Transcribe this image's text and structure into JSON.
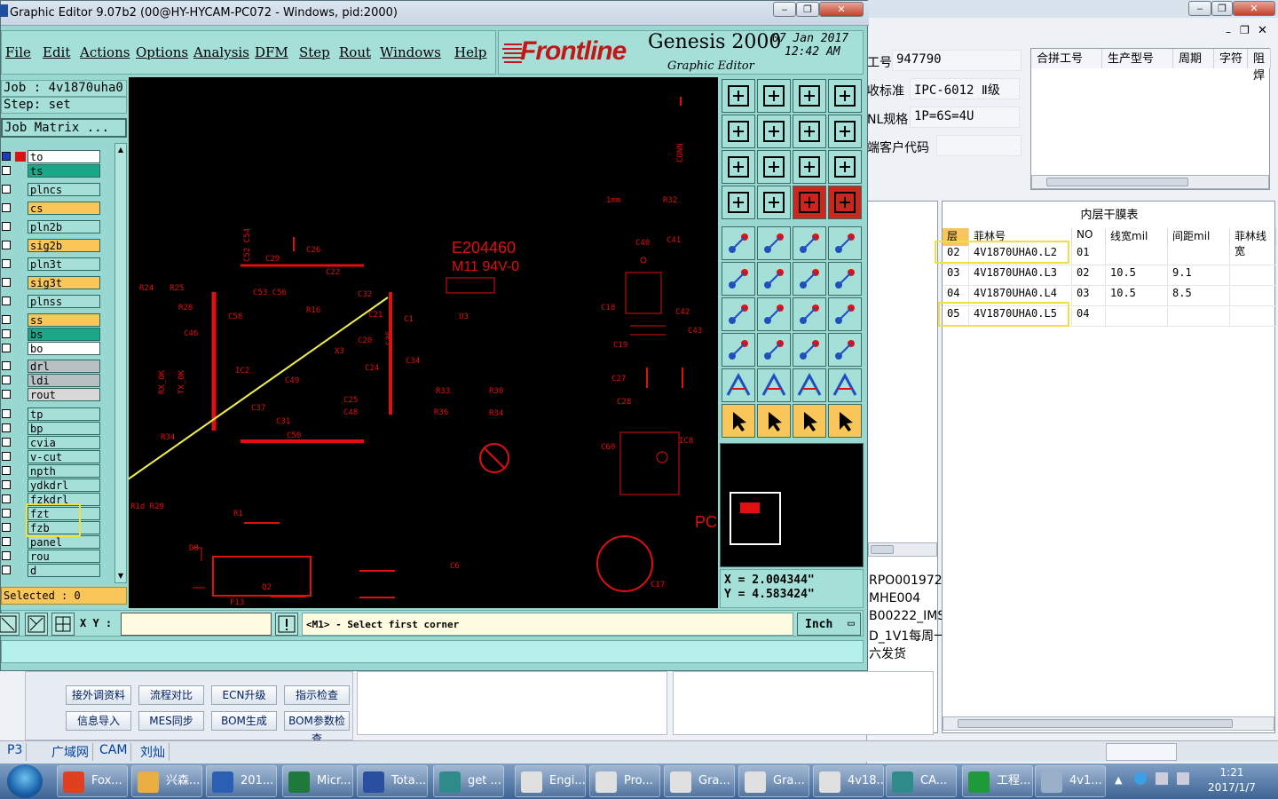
{
  "window": {
    "title": "Graphic Editor 9.07b2 (00@HY-HYCAM-PC072 - Windows, pid:2000)",
    "min_icon": "minimize-icon",
    "max_icon": "maximize-icon",
    "close_icon": "close-icon"
  },
  "menu": [
    "File",
    "Edit",
    "Actions",
    "Options",
    "Analysis",
    "DFM",
    "Step",
    "Rout",
    "Windows",
    "Help"
  ],
  "brand": {
    "logo": "Frontline",
    "product": "Genesis 2000",
    "date": "07 Jan 2017",
    "time": "12:42 AM",
    "subtitle": "Graphic Editor"
  },
  "job": {
    "job_line": "Job : 4v1870uha0",
    "step_line": "Step: set",
    "matrix_button": "Job Matrix ..."
  },
  "layers": [
    {
      "name": "to",
      "color": "#ffffff"
    },
    {
      "name": "ts",
      "color": "#1aa888"
    },
    {
      "name": "plncs",
      "color": "#a5e0d8"
    },
    {
      "name": "cs",
      "color": "#f9c65a"
    },
    {
      "name": "pln2b",
      "color": "#a5e0d8"
    },
    {
      "name": "sig2b",
      "color": "#f9c65a"
    },
    {
      "name": "pln3t",
      "color": "#a5e0d8"
    },
    {
      "name": "sig3t",
      "color": "#f9c65a"
    },
    {
      "name": "plnss",
      "color": "#a5e0d8"
    },
    {
      "name": "ss",
      "color": "#f9c65a"
    },
    {
      "name": "bs",
      "color": "#1aa888"
    },
    {
      "name": "bo",
      "color": "#ffffff"
    },
    {
      "name": "drl",
      "color": "#b8c0c4"
    },
    {
      "name": "ldi",
      "color": "#b8c0c4"
    },
    {
      "name": "rout",
      "color": "#d8d8d8"
    },
    {
      "name": "tp",
      "color": "#a5e0d8"
    },
    {
      "name": "bp",
      "color": "#a5e0d8"
    },
    {
      "name": "cvia",
      "color": "#a5e0d8"
    },
    {
      "name": "v-cut",
      "color": "#a5e0d8"
    },
    {
      "name": "npth",
      "color": "#a5e0d8"
    },
    {
      "name": "ydkdrl",
      "color": "#a5e0d8"
    },
    {
      "name": "fzkdrl",
      "color": "#a5e0d8"
    },
    {
      "name": "fzt",
      "color": "#a5e0d8"
    },
    {
      "name": "fzb",
      "color": "#a5e0d8"
    },
    {
      "name": "panel",
      "color": "#a5e0d8"
    },
    {
      "name": "rou",
      "color": "#a5e0d8"
    },
    {
      "name": "d",
      "color": "#a5e0d8"
    }
  ],
  "selected_line": "Selected : 0",
  "coords": {
    "x_line": "X = 2.004344\"",
    "y_line": "Y = 4.583424\""
  },
  "bottombar": {
    "xy_label": "X Y :",
    "xy_value": "",
    "prompt": "<M1> - Select first corner",
    "unit": "Inch"
  },
  "pcb_labels": {
    "ul": "E204460",
    "material": "M11 94V-0",
    "parts": [
      "R32",
      "1mm",
      "CONN",
      "C26",
      "C29",
      "C22",
      "C52",
      "C54",
      "C32",
      "C21",
      "C1",
      "U3",
      "R24",
      "R25",
      "R28",
      "R26",
      "C53",
      "C56",
      "C58",
      "C46",
      "C33",
      "R16",
      "C30",
      "C36",
      "C20",
      "X3",
      "C24",
      "C34",
      "C40",
      "C41",
      "X1",
      "C42",
      "C18",
      "C43",
      "X2",
      "C19",
      "C27",
      "C28",
      "R33",
      "R30",
      "R36",
      "R34",
      "IC2",
      "C49",
      "C37",
      "C25",
      "C48",
      "C47",
      "C31",
      "C50",
      "R34",
      "RX_OK",
      "TX_OK",
      "C60",
      "IC8",
      "R1d R29",
      "R1",
      "D8",
      "Q2",
      "F13",
      "C6",
      "C5",
      "C17",
      "PC"
    ]
  },
  "bg_app": {
    "fields": [
      {
        "label": "工号",
        "value": "947790"
      },
      {
        "label": "收标准",
        "value": "IPC-6012 Ⅱ级"
      },
      {
        "label": "NL规格",
        "value": "1P=6S=4U"
      },
      {
        "label": "端客户代码",
        "value": ""
      }
    ],
    "grid1_headers": [
      "合拼工号",
      "生产型号",
      "周期",
      "字符",
      "阻焊"
    ],
    "grid2_title": "内层干膜表",
    "grid2_headers": [
      "层",
      "菲林号",
      "NO",
      "线宽mil",
      "间距mil",
      "菲林线宽"
    ],
    "grid2_rows": [
      [
        "02",
        "4V1870UHA0.L2",
        "01",
        "",
        ""
      ],
      [
        "03",
        "4V1870UHA0.L3",
        "02",
        "10.5",
        "9.1"
      ],
      [
        "04",
        "4V1870UHA0.L4",
        "03",
        "10.5",
        "8.5"
      ],
      [
        "05",
        "4V1870UHA0.L5",
        "04",
        "",
        ""
      ]
    ],
    "left_texts": [
      "RPO001972",
      "MHE004",
      "B00222_IMS",
      "D_1V1每周一",
      "六发货"
    ],
    "buttons_row1": [
      "接外调资料",
      "流程对比",
      "ECN升级",
      "指示检查"
    ],
    "buttons_row2": [
      "信息导入",
      "MES同步",
      "BOM生成",
      "BOM参数检查"
    ],
    "status_items": [
      "P3",
      "广域网",
      "CAM",
      "刘灿"
    ]
  },
  "taskbar": {
    "tasks": [
      {
        "label": "Fox...",
        "color": "#e04020"
      },
      {
        "label": "兴森...",
        "color": "#e8b040"
      },
      {
        "label": "201...",
        "color": "#2b5fb4"
      },
      {
        "label": "Micr...",
        "color": "#1e7a3a"
      },
      {
        "label": "Tota...",
        "color": "#2a4fa0"
      },
      {
        "label": "get ...",
        "color": "#2f8a8a"
      },
      {
        "label": "Engi...",
        "color": "#e0e0e0"
      },
      {
        "label": "Pro...",
        "color": "#e0e0e0"
      },
      {
        "label": "Gra...",
        "color": "#e0e0e0"
      },
      {
        "label": "Gra...",
        "color": "#e0e0e0"
      },
      {
        "label": "4v18...",
        "color": "#e0e0e0"
      },
      {
        "label": "CA...",
        "color": "#2f8a8a"
      },
      {
        "label": "工程...",
        "color": "#1e9a3a"
      },
      {
        "label": "4v1...",
        "color": "#9ab0c8"
      }
    ],
    "time": "1:21",
    "date": "2017/1/7"
  }
}
